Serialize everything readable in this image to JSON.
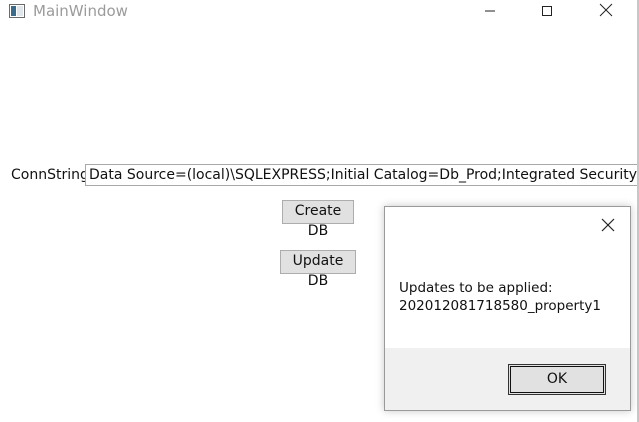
{
  "window": {
    "title": "MainWindow",
    "icon": "wpf-app-icon",
    "controls": {
      "minimize_icon": "minimize-icon",
      "maximize_icon": "maximize-icon",
      "close_icon": "close-icon"
    }
  },
  "form": {
    "conn_label": "ConnString",
    "conn_value": "Data Source=(local)\\SQLEXPRESS;Initial Catalog=Db_Prod;Integrated Security=True",
    "create_db_label": "Create DB",
    "update_db_label": "Update DB"
  },
  "dialog": {
    "message_line1": "Updates to be applied:",
    "message_line2": "202012081718580_property1",
    "ok_label": "OK",
    "close_icon": "close-icon"
  },
  "colors": {
    "title_text": "#9b9b9b",
    "button_bg": "#e1e1e1",
    "dialog_footer_bg": "#f0f0f0"
  }
}
